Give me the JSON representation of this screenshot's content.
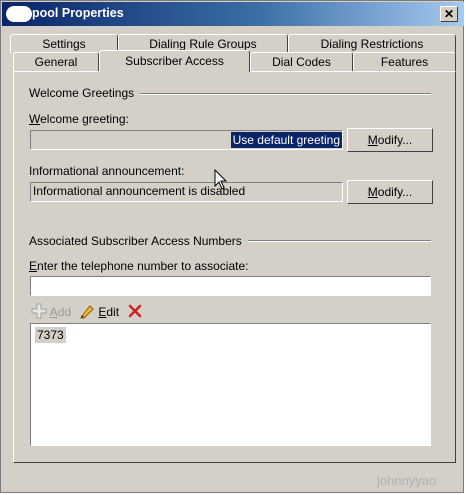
{
  "window": {
    "title": "pool Properties",
    "close_label": "✕"
  },
  "tabs": {
    "row1": [
      "Settings",
      "Dialing Rule Groups",
      "Dialing Restrictions"
    ],
    "row2": [
      "General",
      "Subscriber Access",
      "Dial Codes",
      "Features"
    ],
    "active": "Subscriber Access"
  },
  "welcome_group": {
    "title": "Welcome Greetings",
    "greeting_label_first": "W",
    "greeting_label_rest": "elcome greeting:",
    "greeting_value": "Use default greeting",
    "announcement_label": "Informational announcement:",
    "announcement_value": "Informational announcement is disabled",
    "modify_first": "M",
    "modify_rest": "odify..."
  },
  "access_group": {
    "title": "Associated Subscriber Access Numbers",
    "enter_label_first": "E",
    "enter_label_rest": "nter the telephone number to associate:",
    "phone_input_value": "",
    "add_first": "A",
    "add_rest": "dd",
    "edit_first": "E",
    "edit_rest": "dit",
    "numbers": [
      "7373"
    ]
  },
  "watermark": "johnnyyao",
  "icons": {
    "add": "plus-icon",
    "edit": "pencil-icon",
    "remove": "red-x-icon",
    "cursor": "mouse-pointer-icon"
  }
}
